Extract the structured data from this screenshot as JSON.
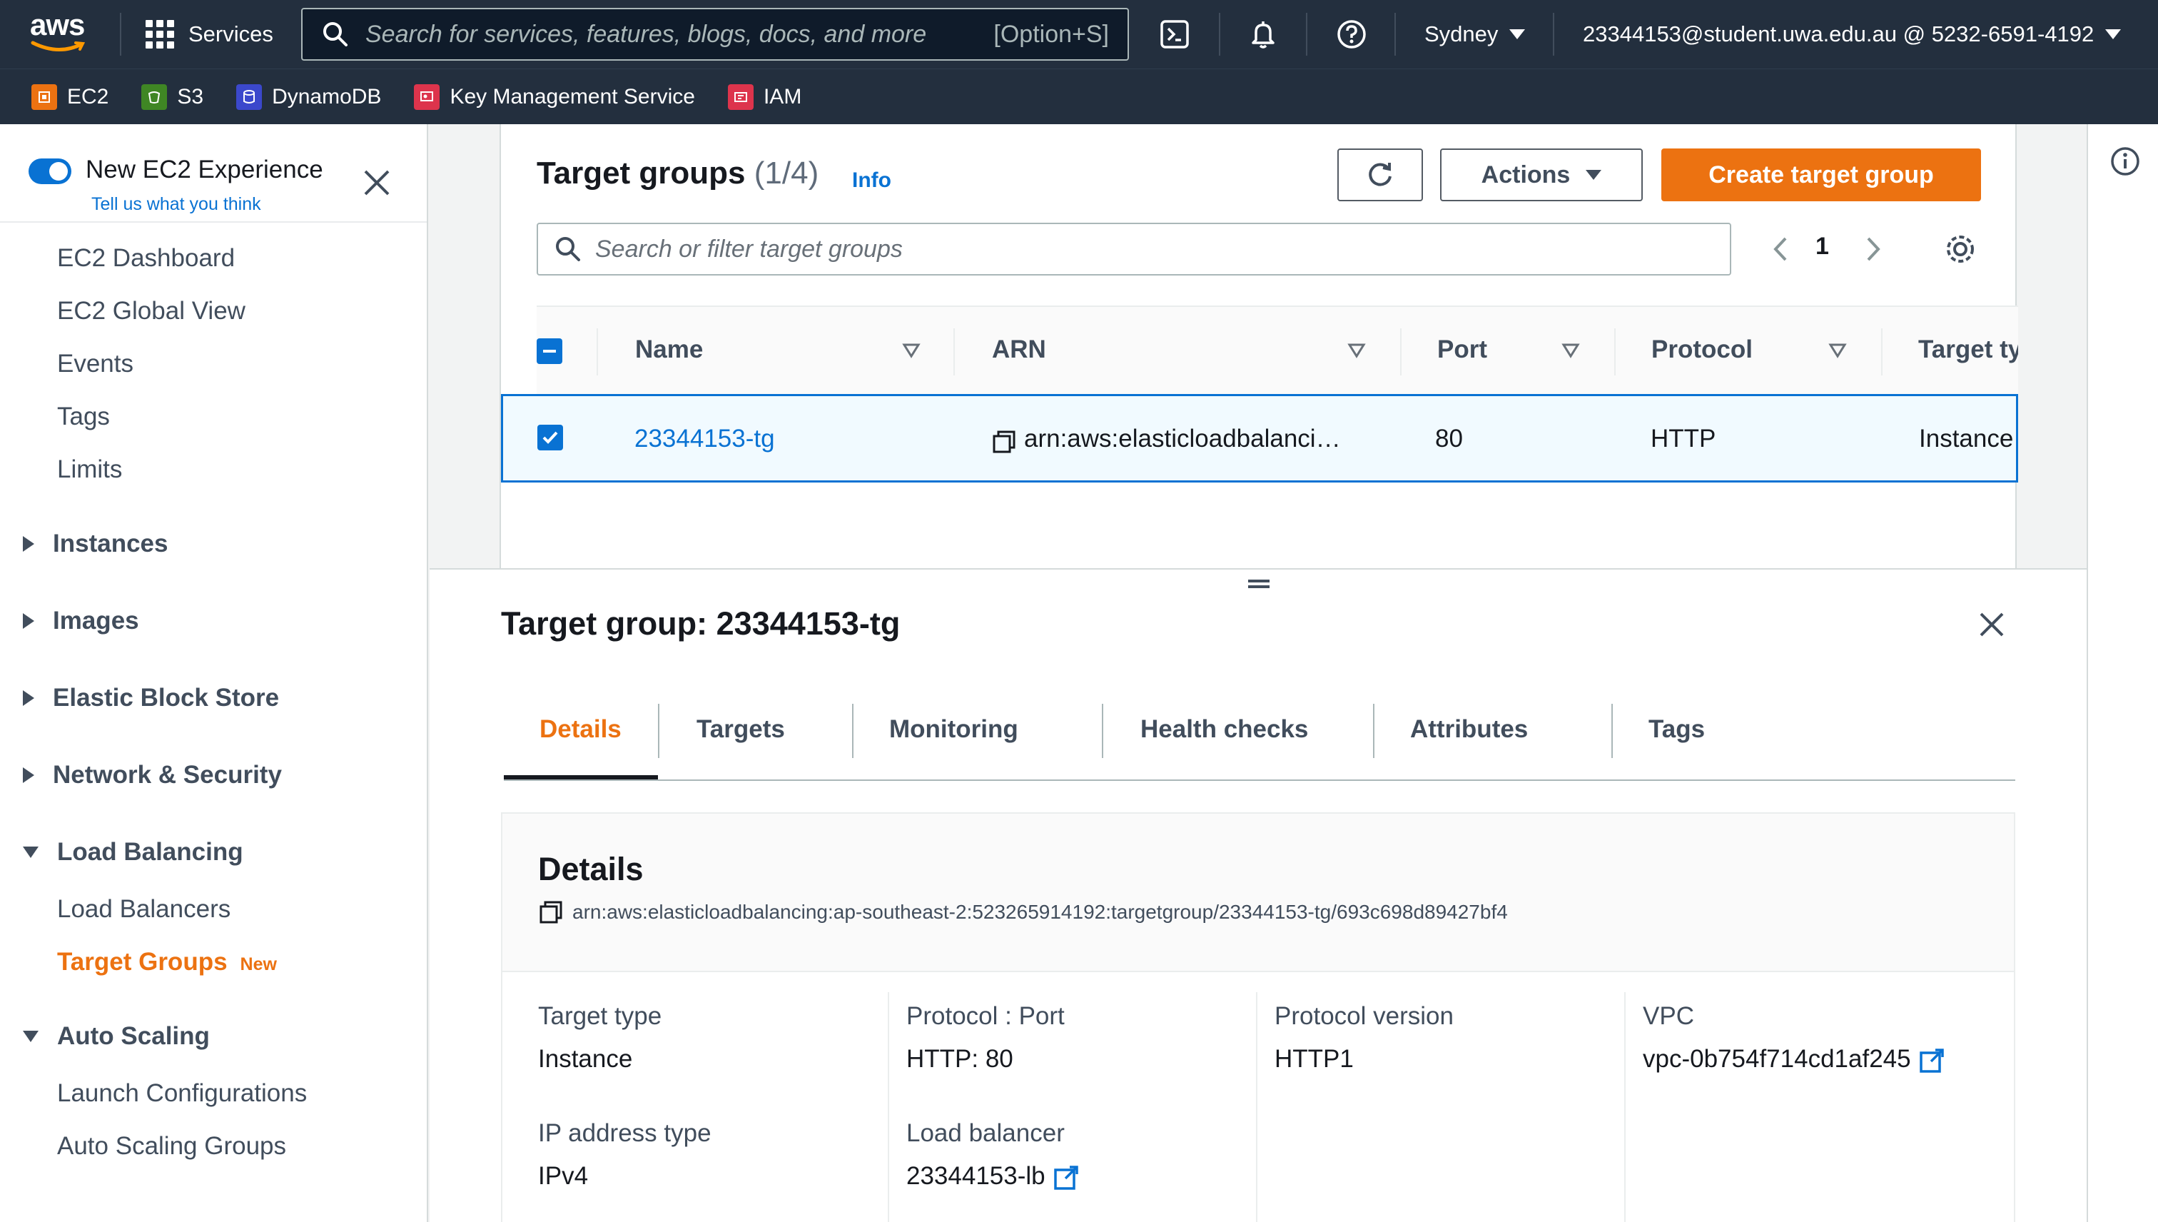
{
  "topnav": {
    "logo_text": "aws",
    "services_label": "Services",
    "search_placeholder": "Search for services, features, blogs, docs, and more",
    "search_shortcut": "[Option+S]",
    "region": "Sydney",
    "account": "23344153@student.uwa.edu.au @ 5232-6591-4192"
  },
  "favorites": [
    {
      "label": "EC2",
      "icon": "ec2-icon",
      "color": "#ec7211"
    },
    {
      "label": "S3",
      "icon": "s3-icon",
      "color": "#3f8624"
    },
    {
      "label": "DynamoDB",
      "icon": "dynamodb-icon",
      "color": "#3b48cc"
    },
    {
      "label": "Key Management Service",
      "icon": "kms-icon",
      "color": "#dd344c"
    },
    {
      "label": "IAM",
      "icon": "iam-icon",
      "color": "#dd344c"
    }
  ],
  "sidebar": {
    "toggle_label": "New EC2 Experience",
    "feedback_link": "Tell us what you think",
    "top_items": [
      "EC2 Dashboard",
      "EC2 Global View",
      "Events",
      "Tags",
      "Limits"
    ],
    "sections": {
      "instances": "Instances",
      "images": "Images",
      "ebs": "Elastic Block Store",
      "network": "Network & Security",
      "load_balancing": "Load Balancing",
      "auto_scaling": "Auto Scaling"
    },
    "lb_items": [
      "Load Balancers",
      "Target Groups"
    ],
    "new_badge": "New",
    "as_items": [
      "Launch Configurations",
      "Auto Scaling Groups"
    ]
  },
  "target_groups": {
    "title": "Target groups",
    "count": "(1/4)",
    "info_link": "Info",
    "actions_label": "Actions",
    "create_label": "Create target group",
    "filter_placeholder": "Search or filter target groups",
    "page": "1",
    "columns": [
      "Name",
      "ARN",
      "Port",
      "Protocol",
      "Target ty"
    ],
    "rows": [
      {
        "name": "23344153-tg",
        "arn": "arn:aws:elasticloadbalanci…",
        "port": "80",
        "protocol": "HTTP",
        "target_type": "Instance"
      }
    ]
  },
  "detail": {
    "title": "Target group: 23344153-tg",
    "tabs": [
      "Details",
      "Targets",
      "Monitoring",
      "Health checks",
      "Attributes",
      "Tags"
    ],
    "card_title": "Details",
    "arn": "arn:aws:elasticloadbalancing:ap-southeast-2:523265914192:targetgroup/23344153-tg/693c698d89427bf4",
    "fields": {
      "target_type_label": "Target type",
      "target_type": "Instance",
      "protocol_port_label": "Protocol : Port",
      "protocol_port": "HTTP: 80",
      "protocol_version_label": "Protocol version",
      "protocol_version": "HTTP1",
      "vpc_label": "VPC",
      "vpc": "vpc-0b754f714cd1af245",
      "ip_type_label": "IP address type",
      "ip_type": "IPv4",
      "lb_label": "Load balancer",
      "lb": "23344153-lb"
    }
  },
  "colors": {
    "nav_bg": "#232f3e",
    "accent_orange": "#ec7211",
    "link_blue": "#0972d3"
  }
}
